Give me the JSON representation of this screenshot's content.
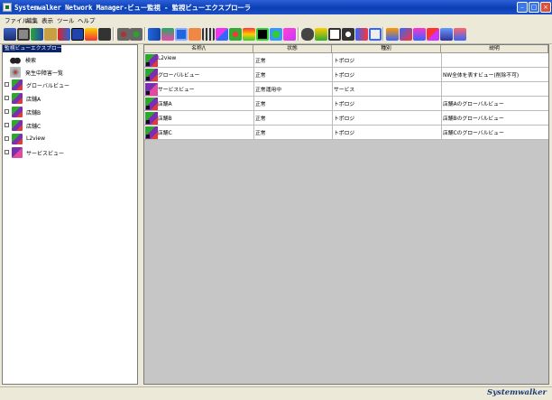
{
  "window": {
    "title": "Systemwalker Network Manager-ビュー監視 - 監視ビューエクスプローラ",
    "min_icon": "minimize-icon",
    "max_icon": "maximize-icon",
    "close_icon": "close-icon"
  },
  "menu": [
    "ファイル",
    "編集",
    "表示",
    "ツール",
    "ヘルプ"
  ],
  "left_pane": {
    "header": "監視ビューエクスプローラ",
    "items": [
      {
        "label": "検索",
        "icon": "binoculars-icon"
      },
      {
        "label": "発生中障害一覧",
        "icon": "alarm-list-icon"
      },
      {
        "label": "グローバルビュー",
        "icon": "network-view-icon"
      },
      {
        "label": "店舗A",
        "icon": "network-view-icon"
      },
      {
        "label": "店舗B",
        "icon": "network-view-icon"
      },
      {
        "label": "店舗C",
        "icon": "network-view-icon"
      },
      {
        "label": "L2view",
        "icon": "network-view-icon"
      },
      {
        "label": "サービスビュー",
        "icon": "service-view-icon"
      }
    ]
  },
  "table": {
    "headers": {
      "name": "名称/\\",
      "status": "状態",
      "type": "種別",
      "desc": "説明"
    },
    "rows": [
      {
        "name": "L2view",
        "status": "正常",
        "type": "トポロジ",
        "desc": ""
      },
      {
        "name": "グローバルビュー",
        "status": "正常",
        "type": "トポロジ",
        "desc": "NW全体を表すビュー(削除不可)"
      },
      {
        "name": "サービスビュー",
        "status": "正常運用中",
        "type": "サービス",
        "desc": ""
      },
      {
        "name": "店舗A",
        "status": "正常",
        "type": "トポロジ",
        "desc": "店舗Aのグローバルビュー"
      },
      {
        "name": "店舗B",
        "status": "正常",
        "type": "トポロジ",
        "desc": "店舗Bのグローバルビュー"
      },
      {
        "name": "店舗C",
        "status": "正常",
        "type": "トポロジ",
        "desc": "店舗Cのグローバルビュー"
      }
    ]
  },
  "status_bar": {
    "brand": "Systemwalker"
  },
  "colors": {
    "title_bar": "#0a3fb4",
    "selection": "#0a246a",
    "row_icon_green": "#2da82d",
    "row_icon_purple": "#7a2fb2"
  }
}
